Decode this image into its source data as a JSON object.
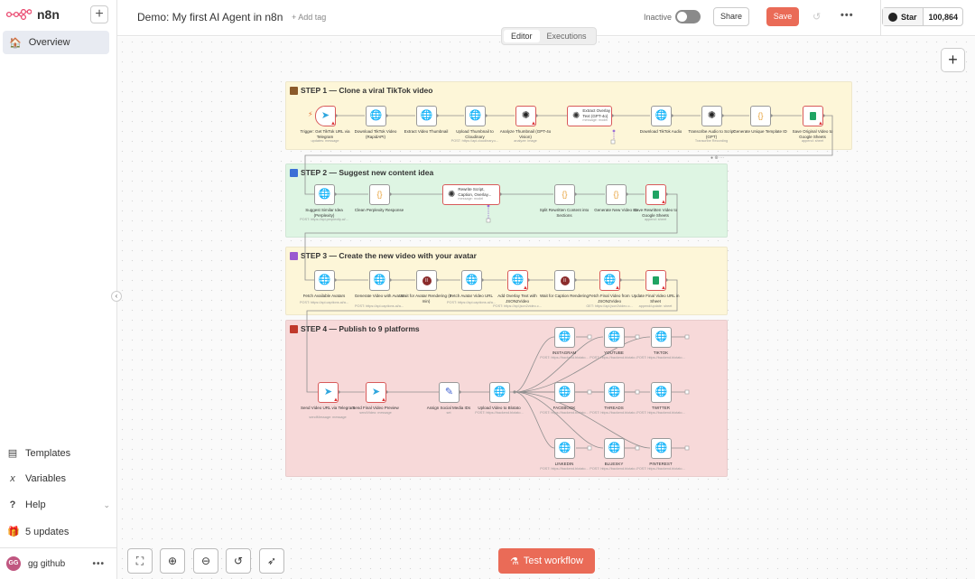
{
  "app": {
    "name": "n8n"
  },
  "sidebar": {
    "overview": "Overview",
    "templates": "Templates",
    "variables": "Variables",
    "help": "Help",
    "updates": "5 updates",
    "user": {
      "initials": "GG",
      "name": "gg github"
    }
  },
  "header": {
    "workflow_title": "Demo: My first AI Agent in n8n",
    "add_tag": "+ Add tag",
    "status": "Inactive",
    "share": "Share",
    "save": "Save",
    "github_star": "Star",
    "star_count": "100,864"
  },
  "tabs": {
    "editor": "Editor",
    "executions": "Executions"
  },
  "steps": {
    "s1": "STEP 1 — Clone a viral TikTok video",
    "s2": "STEP 2 — Suggest new content idea",
    "s3": "STEP 3 — Create the new video with your avatar",
    "s4": "STEP 4 — Publish to 9 platforms"
  },
  "colors": {
    "step1": "#fdf6d8",
    "step2": "#def5e3",
    "step3": "#fdf6d8",
    "step4": "#f7d9d9",
    "accent": "#ea6b57"
  },
  "nodes": {
    "n1": {
      "label": "Trigger: Get TikTok URL via Telegram",
      "sub": "updates: message"
    },
    "n2": {
      "label": "Download TikTok Video (RapidAPI)",
      "sub": ""
    },
    "n3": {
      "label": "Extract Video Thumbnail",
      "sub": ""
    },
    "n4": {
      "label": "Upload Thumbnail to Cloudinary",
      "sub": "POST: https://api.cloudinary.c..."
    },
    "n5": {
      "label": "Analyze Thumbnail (GPT-4o Vision)",
      "sub": "analyze: image"
    },
    "n6": {
      "label": "Extract Overlay Text (GPT-4o)",
      "sub": "message: model"
    },
    "n7": {
      "label": "Download TikTok Audio",
      "sub": ""
    },
    "n8": {
      "label": "Transcribe Audio to Script (GPT)",
      "sub": "Transcribe Recording"
    },
    "n9": {
      "label": "Generate Unique Template ID",
      "sub": ""
    },
    "n10": {
      "label": "Save Original Video to Google Sheets",
      "sub": "append: sheet"
    },
    "m1": {
      "label": "Suggest Similar Idea (Perplexity)",
      "sub": "POST: https://api.perplexity.ai/..."
    },
    "m2": {
      "label": "Clean Perplexity Response",
      "sub": ""
    },
    "m3": {
      "label": "Rewrite Script, Caption, Overlay...",
      "sub": "message: model"
    },
    "m4": {
      "label": "Split Rewritten Content into Sections",
      "sub": ""
    },
    "m5": {
      "label": "Generate New Video ID",
      "sub": ""
    },
    "m6": {
      "label": "Save Rewritten Video to Google Sheets",
      "sub": "append: sheet"
    },
    "p1": {
      "label": "Fetch Available Avatars",
      "sub": "POST: https://api.captions.ai/a..."
    },
    "p2": {
      "label": "Generate Video with Avatar",
      "sub": "POST: https://api.captions.ai/a..."
    },
    "p3": {
      "label": "Wait for Avatar Rendering (3 min)",
      "sub": ""
    },
    "p4": {
      "label": "Fetch Avatar Video URL",
      "sub": "POST: https://api.captions.ai/a..."
    },
    "p5": {
      "label": "Add Overlay Text with JSON2Video",
      "sub": "POST: https://api.json2video.c..."
    },
    "p6": {
      "label": "Wait for Caption Rendering",
      "sub": ""
    },
    "p7": {
      "label": "Fetch Final Video from JSON2Video",
      "sub": "GET: https://api.json2video.c..."
    },
    "p8": {
      "label": "Update Final Video URL in Sheet",
      "sub": "append/update: sheet"
    },
    "q1": {
      "label": "Send Video URL via Telegram",
      "sub": "sendMessage: message"
    },
    "q2": {
      "label": "Send Final Video Preview",
      "sub": "sendVideo: message"
    },
    "q3": {
      "label": "Assign Social Media IDs",
      "sub": "set"
    },
    "q4": {
      "label": "Upload Video to Blotato",
      "sub": "POST: https://backend.blotato..."
    },
    "r1": {
      "label": "INSTAGRAM",
      "sub": "POST: https://backend.blotato..."
    },
    "r2": {
      "label": "YOUTUBE",
      "sub": "POST: https://backend.blotato..."
    },
    "r3": {
      "label": "TIKTOK",
      "sub": "POST: https://backend.blotato..."
    },
    "r4": {
      "label": "FACEBOOK",
      "sub": "POST: https://backend.blotato..."
    },
    "r5": {
      "label": "THREADS",
      "sub": "POST: https://backend.blotato..."
    },
    "r6": {
      "label": "TWITTER",
      "sub": "POST: https://backend.blotato..."
    },
    "r7": {
      "label": "LINKEDIN",
      "sub": "POST: https://backend.blotato..."
    },
    "r8": {
      "label": "BLUESKY",
      "sub": "POST: https://backend.blotato..."
    },
    "r9": {
      "label": "PINTEREST",
      "sub": "POST: https://backend.blotato..."
    }
  },
  "footer": {
    "test_workflow": "Test workflow"
  },
  "icons": {
    "telegram": "telegram-icon",
    "http": "globe-icon",
    "openai": "openai-icon",
    "code": "code-braces-icon",
    "sheets": "google-sheets-icon",
    "wait": "pause-icon",
    "set": "pen-icon"
  }
}
